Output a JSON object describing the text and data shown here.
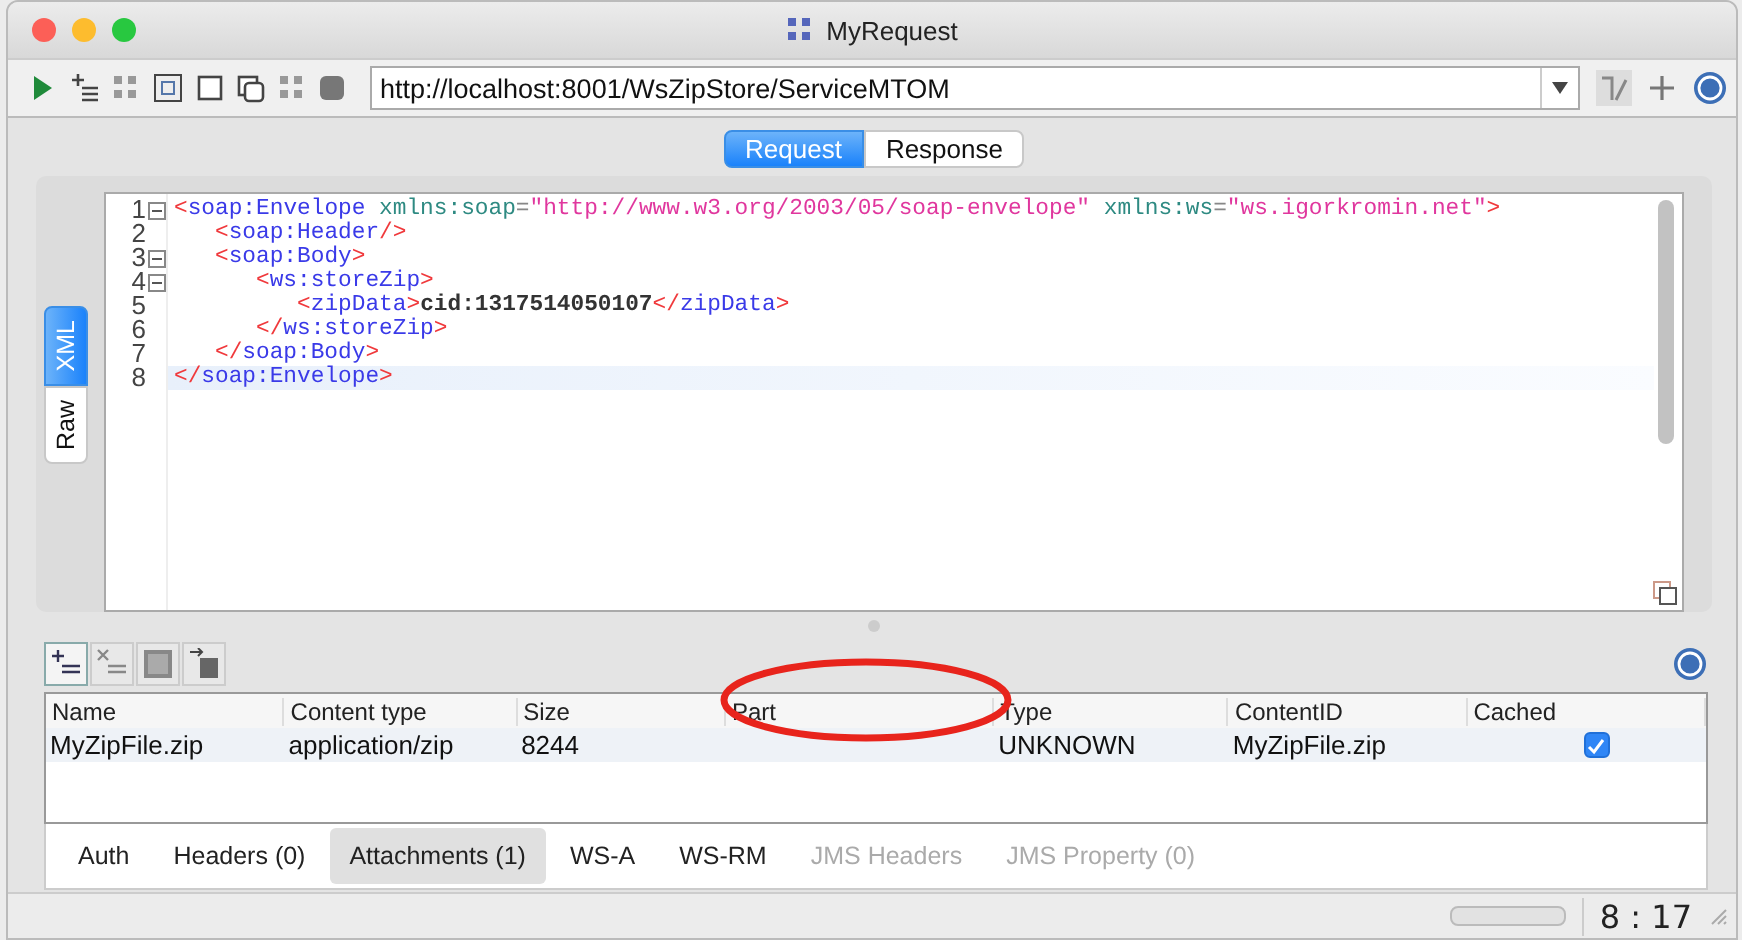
{
  "window": {
    "title": "MyRequest"
  },
  "toolbar": {
    "url": "http://localhost:8001/WsZipStore/ServiceMTOM"
  },
  "message_tabs": [
    {
      "label": "Request",
      "selected": true
    },
    {
      "label": "Response",
      "selected": false
    }
  ],
  "side_tabs": [
    {
      "label": "XML",
      "selected": true
    },
    {
      "label": "Raw",
      "selected": false
    }
  ],
  "editor": {
    "lines": [
      {
        "number": "1",
        "foldable": true,
        "current": false,
        "tokens": [
          {
            "kind": "bracket",
            "text": "<"
          },
          {
            "kind": "tag",
            "text": "soap:Envelope"
          },
          {
            "kind": "attr",
            "text": " xmlns:soap"
          },
          {
            "kind": "eq",
            "text": "="
          },
          {
            "kind": "value",
            "text": "\"http://www.w3.org/2003/05/soap-envelope\""
          },
          {
            "kind": "attr",
            "text": " xmlns:ws"
          },
          {
            "kind": "eq",
            "text": "="
          },
          {
            "kind": "value",
            "text": "\"ws.igorkromin.net\""
          },
          {
            "kind": "bracket",
            "text": ">"
          }
        ],
        "children": [
          {
            "number": "2",
            "foldable": false,
            "current": false,
            "tokens": [
              {
                "kind": "bracket",
                "text": "<"
              },
              {
                "kind": "tag",
                "text": "soap:Header"
              },
              {
                "kind": "bracket",
                "text": "/>"
              }
            ]
          },
          {
            "number": "3",
            "foldable": true,
            "current": false,
            "tokens": [
              {
                "kind": "bracket",
                "text": "<"
              },
              {
                "kind": "tag",
                "text": "soap:Body"
              },
              {
                "kind": "bracket",
                "text": ">"
              }
            ],
            "children": [
              {
                "number": "4",
                "foldable": true,
                "current": false,
                "tokens": [
                  {
                    "kind": "bracket",
                    "text": "<"
                  },
                  {
                    "kind": "tag",
                    "text": "ws:storeZip"
                  },
                  {
                    "kind": "bracket",
                    "text": ">"
                  }
                ],
                "children": [
                  {
                    "number": "5",
                    "foldable": false,
                    "current": false,
                    "tokens": [
                      {
                        "kind": "bracket",
                        "text": "<"
                      },
                      {
                        "kind": "tag",
                        "text": "zipData"
                      },
                      {
                        "kind": "bracket",
                        "text": ">"
                      },
                      {
                        "kind": "text",
                        "text": "cid:1317514050107"
                      },
                      {
                        "kind": "bracket",
                        "text": "</"
                      },
                      {
                        "kind": "tag",
                        "text": "zipData"
                      },
                      {
                        "kind": "bracket",
                        "text": ">"
                      }
                    ]
                  }
                ]
              },
              {
                "number": "6",
                "foldable": false,
                "current": false,
                "tokens": [
                  {
                    "kind": "bracket",
                    "text": "</"
                  },
                  {
                    "kind": "tag",
                    "text": "ws:storeZip"
                  },
                  {
                    "kind": "bracket",
                    "text": ">"
                  }
                ]
              }
            ]
          },
          {
            "number": "7",
            "foldable": false,
            "current": false,
            "tokens": [
              {
                "kind": "bracket",
                "text": "</"
              },
              {
                "kind": "tag",
                "text": "soap:Body"
              },
              {
                "kind": "bracket",
                "text": ">"
              }
            ]
          }
        ]
      },
      {
        "number": "8",
        "foldable": false,
        "current": true,
        "tokens": [
          {
            "kind": "bracket",
            "text": "</"
          },
          {
            "kind": "tag",
            "text": "soap:Envelope"
          },
          {
            "kind": "bracket",
            "text": ">"
          }
        ]
      }
    ]
  },
  "attachments": {
    "columns": [
      "Name",
      "Content type",
      "Size",
      "Part",
      "Type",
      "ContentID",
      "Cached"
    ],
    "rows": [
      {
        "name": "MyZipFile.zip",
        "content_type": "application/zip",
        "size": "8244",
        "type": "UNKNOWN",
        "content_id": "MyZipFile.zip",
        "cached": true
      }
    ]
  },
  "bottom_tabs": [
    {
      "label": "Auth",
      "selected": false,
      "disabled": false
    },
    {
      "label": "Headers (0)",
      "selected": false,
      "disabled": false
    },
    {
      "label": "Attachments (1)",
      "selected": true,
      "disabled": false
    },
    {
      "label": "WS-A",
      "selected": false,
      "disabled": false
    },
    {
      "label": "WS-RM",
      "selected": false,
      "disabled": false
    },
    {
      "label": "JMS Headers",
      "selected": false,
      "disabled": true
    },
    {
      "label": "JMS Property (0)",
      "selected": false,
      "disabled": true
    }
  ],
  "status_bar": {
    "position": "8 : 17"
  }
}
